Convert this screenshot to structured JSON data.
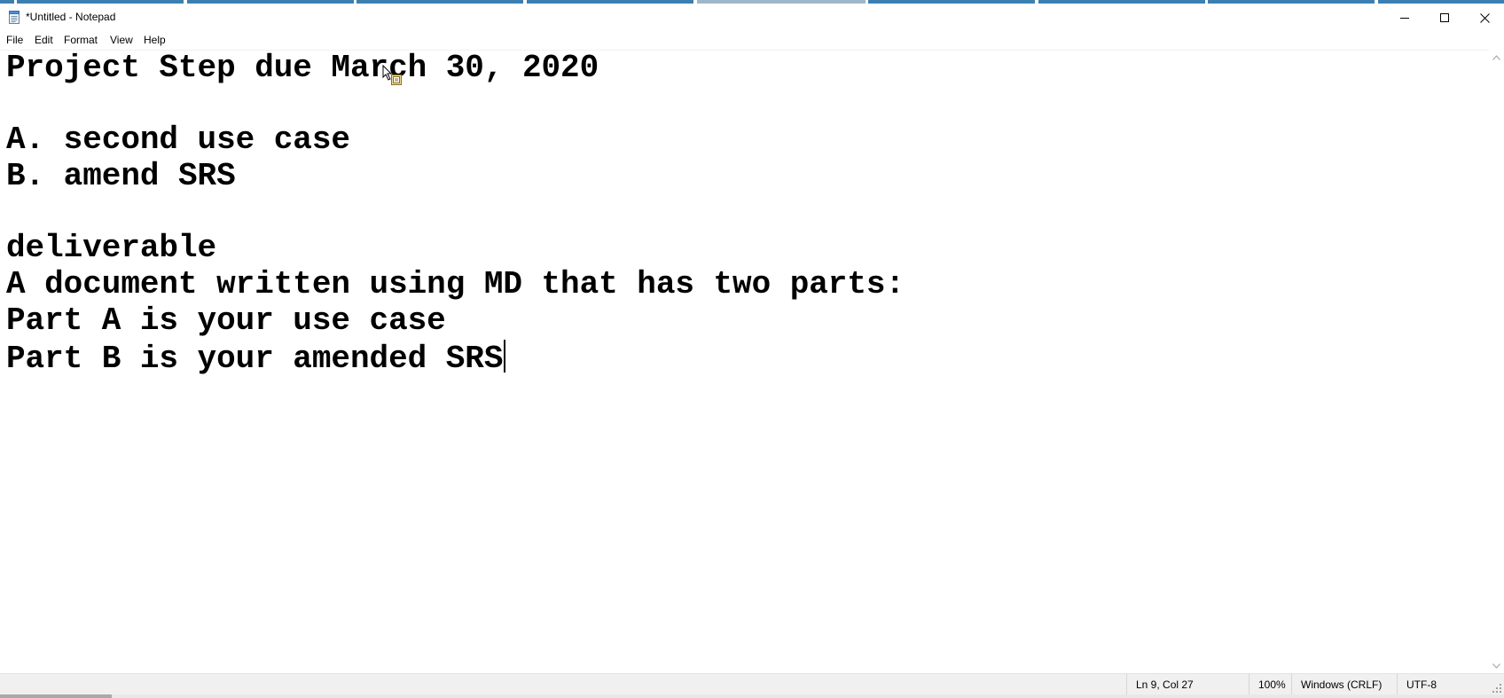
{
  "window": {
    "title": "*Untitled - Notepad",
    "app_icon": "notepad-icon"
  },
  "window_controls": {
    "minimize": "minimize-icon",
    "maximize": "maximize-icon",
    "close": "close-icon"
  },
  "menu": {
    "items": [
      {
        "label": "File"
      },
      {
        "label": "Edit"
      },
      {
        "label": "Format"
      },
      {
        "label": "View"
      },
      {
        "label": "Help"
      }
    ]
  },
  "document": {
    "lines": [
      "Project Step due March 30, 2020",
      "",
      "A. second use case",
      "B. amend SRS",
      "",
      "deliverable",
      "A document written using MD that has two parts:",
      "Part A is your use case",
      "Part B is your amended SRS"
    ]
  },
  "status": {
    "position": "Ln 9, Col 27",
    "zoom": "100%",
    "line_ending": "Windows (CRLF)",
    "encoding": "UTF-8"
  },
  "colors": {
    "taskbar_accent": "#3c7fb1",
    "statusbar_bg": "#f0f0f0",
    "text": "#000000"
  }
}
